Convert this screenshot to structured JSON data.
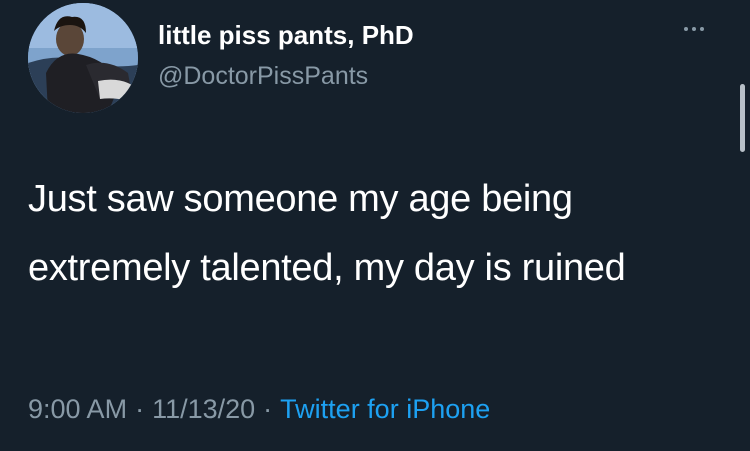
{
  "tweet": {
    "display_name": "little piss pants, PhD",
    "handle": "@DoctorPissPants",
    "text": "Just saw someone my age being extremely talented, my day is ruined",
    "time": "9:00 AM",
    "separator": "·",
    "date": "11/13/20",
    "source": "Twitter for iPhone"
  },
  "icons": {
    "avatar": "profile-photo",
    "more": "more-options-icon"
  },
  "colors": {
    "background": "#15202b",
    "primary_text": "#ffffff",
    "secondary_text": "#8899a6",
    "link": "#1da1f2"
  }
}
